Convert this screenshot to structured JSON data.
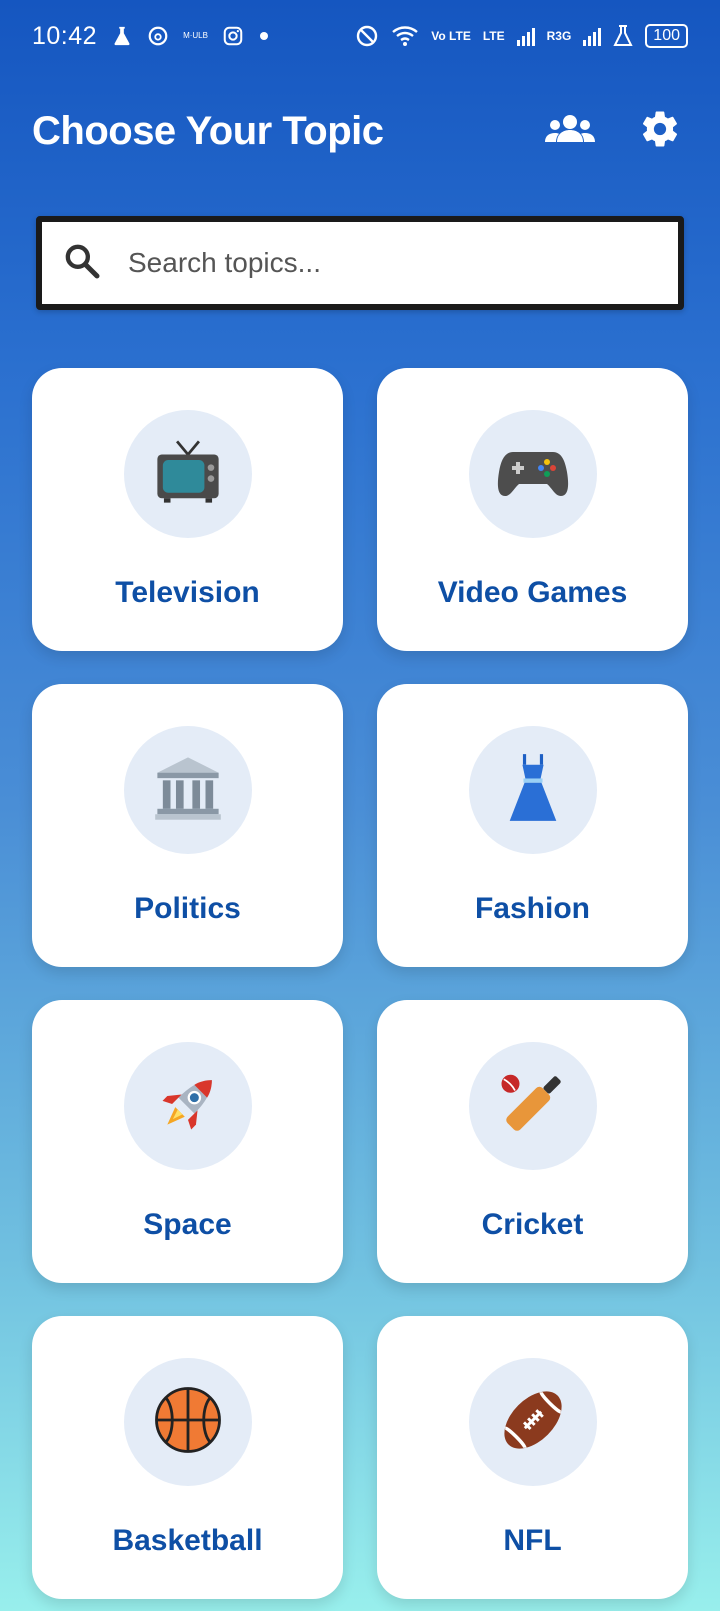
{
  "status_bar": {
    "time": "10:42",
    "network_badge": "M·ULB",
    "volte": "Vo LTE",
    "lte": "LTE",
    "r3g": "R3G",
    "battery": "100"
  },
  "header": {
    "title": "Choose Your Topic",
    "icons": [
      "group-icon",
      "gear-icon"
    ]
  },
  "search": {
    "placeholder": "Search topics..."
  },
  "topics": [
    {
      "label": "Television",
      "icon": "television-icon"
    },
    {
      "label": "Video Games",
      "icon": "game-controller-icon"
    },
    {
      "label": "Politics",
      "icon": "classical-building-icon"
    },
    {
      "label": "Fashion",
      "icon": "dress-icon"
    },
    {
      "label": "Space",
      "icon": "rocket-icon"
    },
    {
      "label": "Cricket",
      "icon": "cricket-bat-ball-icon"
    },
    {
      "label": "Basketball",
      "icon": "basketball-icon"
    },
    {
      "label": "NFL",
      "icon": "american-football-icon"
    }
  ],
  "colors": {
    "accent": "#0e4fa5",
    "gradient_top": "#1556c0",
    "gradient_bottom": "#98efec",
    "icon_circle": "#e4ecf7"
  }
}
